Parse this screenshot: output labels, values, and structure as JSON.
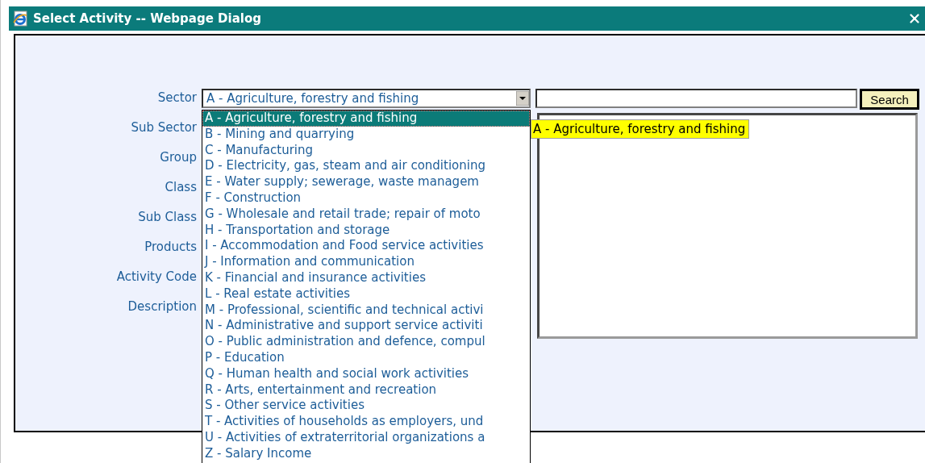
{
  "window": {
    "title": "Select Activity -- Webpage Dialog"
  },
  "form": {
    "labels": [
      {
        "text": "Sector",
        "kind": "select"
      },
      {
        "text": "Sub Sector",
        "kind": "hidden"
      },
      {
        "text": "Group",
        "kind": "hidden"
      },
      {
        "text": "Class",
        "kind": "hidden"
      },
      {
        "text": "Sub Class",
        "kind": "hidden"
      },
      {
        "text": "Products",
        "kind": "hidden"
      },
      {
        "text": "Activity Code",
        "kind": "hidden"
      },
      {
        "text": "Description",
        "kind": "hidden"
      }
    ],
    "sector_value": "A - Agriculture, forestry and fishing"
  },
  "search": {
    "button": "Search"
  },
  "dropdown": {
    "items": [
      {
        "label": "A - Agriculture, forestry and fishing",
        "selected": true
      },
      {
        "label": "B - Mining and quarrying",
        "selected": false
      },
      {
        "label": "C - Manufacturing",
        "selected": false
      },
      {
        "label": "D - Electricity, gas, steam and air conditioning",
        "selected": false
      },
      {
        "label": "E - Water supply; sewerage, waste managem",
        "selected": false
      },
      {
        "label": "F - Construction",
        "selected": false
      },
      {
        "label": "G - Wholesale and retail trade; repair of moto",
        "selected": false
      },
      {
        "label": "H - Transportation and storage",
        "selected": false
      },
      {
        "label": "I - Accommodation and Food service activities",
        "selected": false
      },
      {
        "label": "J - Information and communication",
        "selected": false
      },
      {
        "label": "K - Financial and insurance activities",
        "selected": false
      },
      {
        "label": "L - Real estate activities",
        "selected": false
      },
      {
        "label": "M - Professional, scientific and technical activi",
        "selected": false
      },
      {
        "label": "N - Administrative and support service activiti",
        "selected": false
      },
      {
        "label": "O - Public administration and defence, compul",
        "selected": false
      },
      {
        "label": "P - Education",
        "selected": false
      },
      {
        "label": "Q - Human health and social work activities",
        "selected": false
      },
      {
        "label": "R - Arts, entertainment and recreation",
        "selected": false
      },
      {
        "label": "S - Other service activities",
        "selected": false
      },
      {
        "label": "T - Activities of households as employers, und",
        "selected": false
      },
      {
        "label": "U - Activities of extraterritorial organizations a",
        "selected": false
      },
      {
        "label": "Z - Salary Income",
        "selected": false
      }
    ]
  },
  "tooltip": "A - Agriculture, forestry and fishing"
}
